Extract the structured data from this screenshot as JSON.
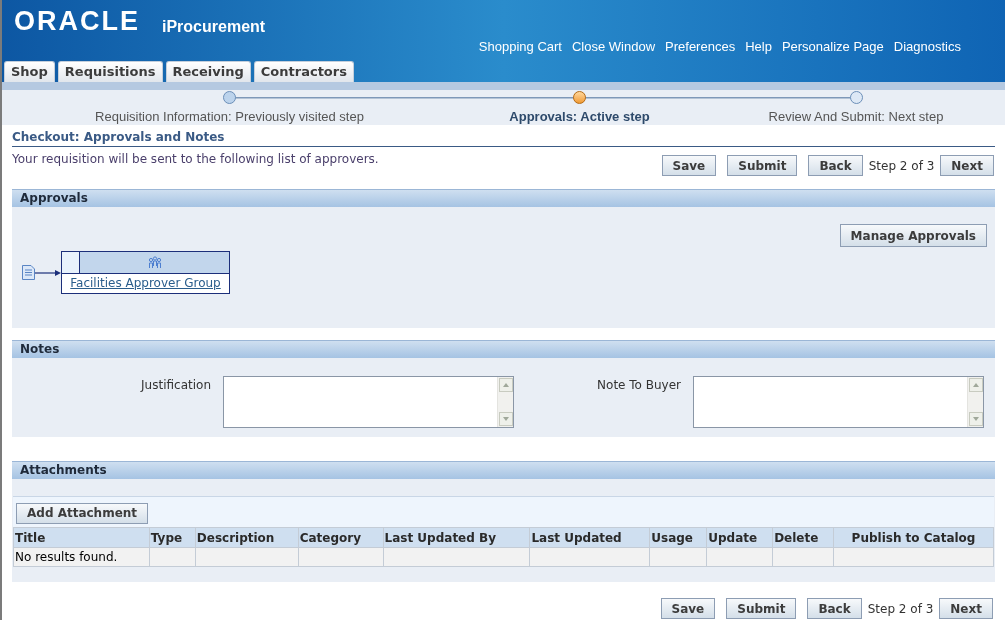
{
  "header": {
    "logo": "ORACLE",
    "app_title": "iProcurement",
    "links": [
      "Shopping Cart",
      "Close Window",
      "Preferences",
      "Help",
      "Personalize Page",
      "Diagnostics"
    ]
  },
  "tabs": [
    {
      "label": "Shop",
      "selected": false
    },
    {
      "label": "Requisitions",
      "selected": false
    },
    {
      "label": "Receiving",
      "selected": false
    },
    {
      "label": "Contractors",
      "selected": false
    }
  ],
  "train": [
    {
      "label": "Requisition Information: Previously visited step",
      "kind": "visited"
    },
    {
      "label": "Approvals: Active step",
      "kind": "active"
    },
    {
      "label": "Review And Submit: Next step",
      "kind": "next"
    }
  ],
  "page": {
    "title": "Checkout: Approvals and Notes",
    "description": "Your requisition will be sent to the following list of approvers."
  },
  "top_actions": {
    "buttons": [
      "Save",
      "Submit",
      "Back"
    ],
    "step": "Step 2 of 3",
    "next": "Next"
  },
  "approvals": {
    "title": "Approvals",
    "manage_button": "Manage Approvals",
    "approver": "Facilities Approver Group"
  },
  "notes": {
    "title": "Notes",
    "fields": [
      {
        "label": "Justification"
      },
      {
        "label": "Note To Buyer"
      }
    ]
  },
  "attachments": {
    "title": "Attachments",
    "add_button": "Add Attachment",
    "columns": [
      "Title",
      "Type",
      "Description",
      "Category",
      "Last Updated By",
      "Last Updated",
      "Usage",
      "Update",
      "Delete",
      "Publish to Catalog"
    ],
    "empty_message": "No results found."
  },
  "bottom_actions": {
    "buttons": [
      "Save",
      "Submit",
      "Back"
    ],
    "step": "Step 2 of 3",
    "next": "Next"
  }
}
